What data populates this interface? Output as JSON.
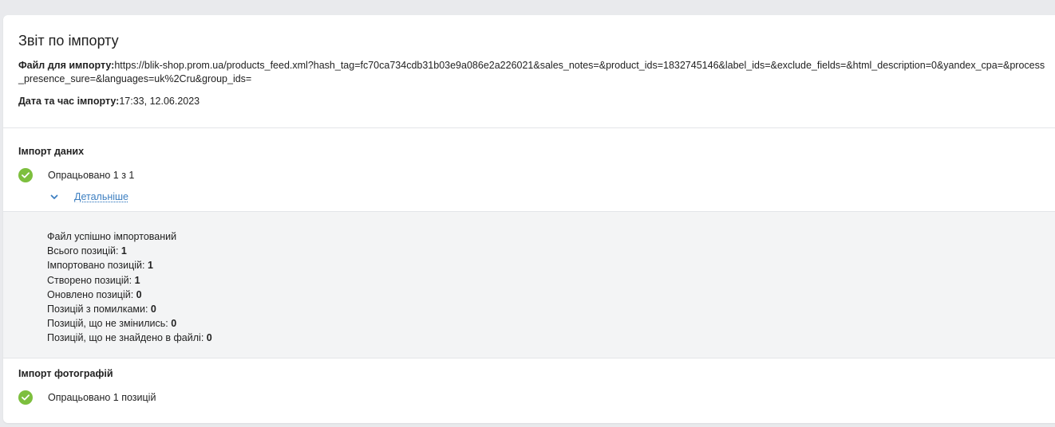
{
  "report": {
    "title": "Звіт по імпорту",
    "file_label": "Файл для импорту:",
    "file_url": "https://blik-shop.prom.ua/products_feed.xml?hash_tag=fc70ca734cdb31b03e9a086e2a226021&sales_notes=&product_ids=1832745146&label_ids=&exclude_fields=&html_description=0&yandex_cpa=&process_presence_sure=&languages=uk%2Cru&group_ids=",
    "date_label": "Дата та час імпорту:",
    "date_value": "17:33, 12.06.2023"
  },
  "data_import": {
    "title": "Імпорт даних",
    "status_text": "Опрацьовано 1 з 1",
    "details_link": "Детальніше",
    "details": {
      "success_text": "Файл успішно імпортований",
      "rows": [
        {
          "label": "Всього позицій: ",
          "value": "1"
        },
        {
          "label": "Імпортовано позицій: ",
          "value": "1"
        },
        {
          "label": "Створено позицій: ",
          "value": "1"
        },
        {
          "label": "Оновлено позицій: ",
          "value": "0"
        },
        {
          "label": "Позицій з помилками: ",
          "value": "0"
        },
        {
          "label": "Позицій, що не змінились: ",
          "value": "0"
        },
        {
          "label": "Позицій, що не знайдено в файлі: ",
          "value": "0"
        }
      ]
    }
  },
  "photo_import": {
    "title": "Імпорт фотографій",
    "status_text": "Опрацьовано 1 позицій"
  },
  "colors": {
    "success_green": "#7dbf3e",
    "link_blue": "#3d7fc1",
    "panel_gray": "#f3f4f5"
  },
  "icons": {
    "status": "check-circle-icon",
    "toggle": "chevron-down-icon"
  }
}
